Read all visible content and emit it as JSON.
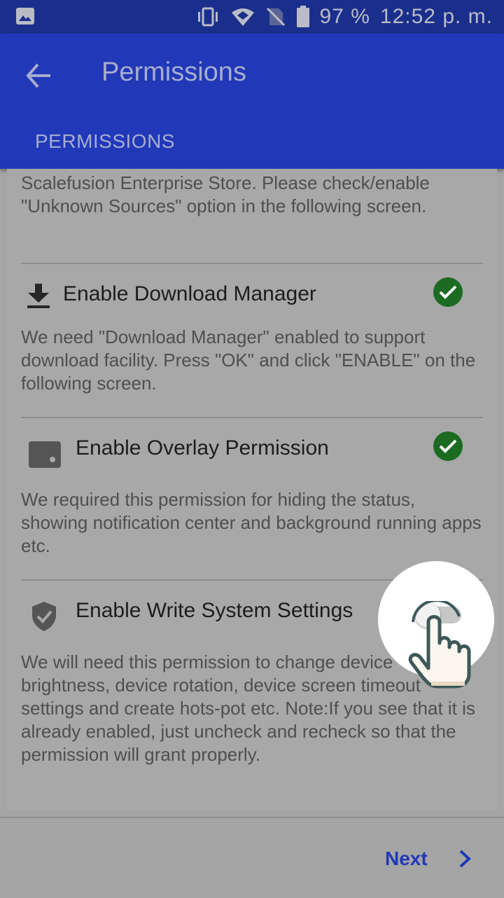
{
  "status_bar": {
    "battery": "97 %",
    "time": "12:52 p. m.",
    "icons": [
      "image-icon",
      "vibrate-icon",
      "wifi-icon",
      "no-sim-icon",
      "battery-icon"
    ]
  },
  "app_bar": {
    "title": "Permissions",
    "tab": "PERMISSIONS"
  },
  "content": {
    "intro_text": "Scalefusion Enterprise Store. Please check/enable \"Unknown Sources\" option in the following screen.",
    "items": [
      {
        "title": "Enable Download Manager",
        "icon": "download-icon",
        "enabled": true,
        "description": "We need \"Download Manager\" enabled to support download facility. Press \"OK\" and click \"ENABLE\" on the following screen."
      },
      {
        "title": "Enable Overlay Permission",
        "icon": "overlay-icon",
        "enabled": true,
        "description": "We required this permission for hiding the status, showing notification center and background running apps etc."
      },
      {
        "title": "Enable Write System Settings",
        "icon": "shield-check-icon",
        "enabled": false,
        "description": "We will need this permission to change device brightness, device rotation, device screen timeout settings and create hots-pot etc. Note:If you see that it is already enabled, just uncheck and recheck so that the permission will grant properly."
      }
    ]
  },
  "footer": {
    "next_label": "Next"
  },
  "colors": {
    "status_bar": "#1a2f8c",
    "app_bar": "#2138b8",
    "background": "#a5a5a5",
    "check_green": "#1c6b22",
    "link_blue": "#2138b8"
  }
}
